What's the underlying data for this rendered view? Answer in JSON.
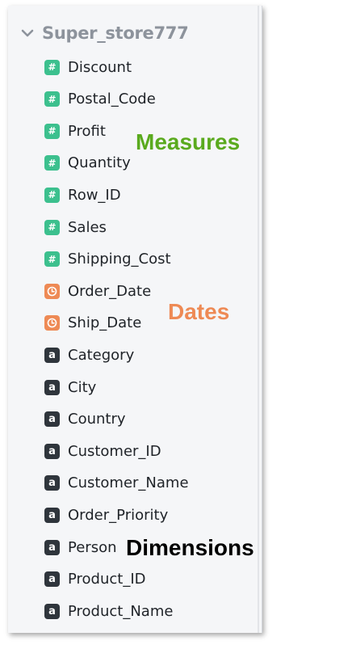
{
  "panel": {
    "title": "Super_store777"
  },
  "fields": [
    {
      "label": "Discount",
      "type": "measure"
    },
    {
      "label": "Postal_Code",
      "type": "measure"
    },
    {
      "label": "Profit",
      "type": "measure"
    },
    {
      "label": "Quantity",
      "type": "measure"
    },
    {
      "label": "Row_ID",
      "type": "measure"
    },
    {
      "label": "Sales",
      "type": "measure"
    },
    {
      "label": "Shipping_Cost",
      "type": "measure"
    },
    {
      "label": "Order_Date",
      "type": "date"
    },
    {
      "label": "Ship_Date",
      "type": "date"
    },
    {
      "label": "Category",
      "type": "dimension"
    },
    {
      "label": "City",
      "type": "dimension"
    },
    {
      "label": "Country",
      "type": "dimension"
    },
    {
      "label": "Customer_ID",
      "type": "dimension"
    },
    {
      "label": "Customer_Name",
      "type": "dimension"
    },
    {
      "label": "Order_Priority",
      "type": "dimension"
    },
    {
      "label": "Person",
      "type": "dimension"
    },
    {
      "label": "Product_ID",
      "type": "dimension"
    },
    {
      "label": "Product_Name",
      "type": "dimension"
    }
  ],
  "icons": {
    "measure": {
      "glyph": "#",
      "name": "hash-icon",
      "color": "#3cc08e"
    },
    "date": {
      "glyph": "clock",
      "name": "clock-icon",
      "color": "#ee8a55"
    },
    "dimension": {
      "glyph": "a",
      "name": "text-a-icon",
      "color": "#2f353c"
    }
  },
  "annotations": {
    "measures": {
      "text": "Measures",
      "color": "#5aaa1e"
    },
    "dates": {
      "text": "Dates",
      "color": "#ee8a55"
    },
    "dimensions": {
      "text": "Dimensions",
      "color": "#000000"
    }
  }
}
